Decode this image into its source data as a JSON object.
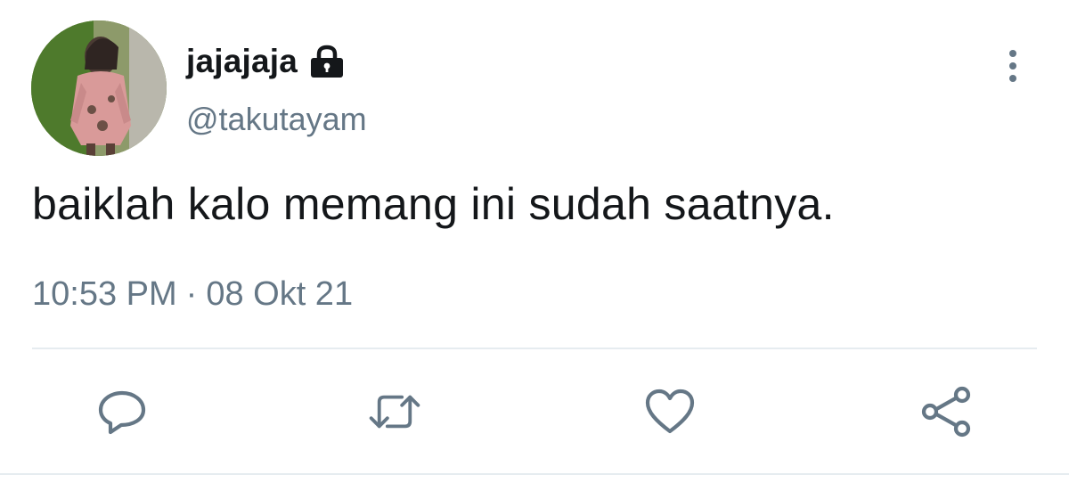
{
  "user": {
    "display_name": "jajajaja",
    "handle": "@takutayam",
    "protected_icon": "lock-icon",
    "avatar": "profile-photo"
  },
  "tweet": {
    "text": "baiklah kalo memang ini sudah saatnya.",
    "time": "10:53 PM",
    "separator": "·",
    "date": "08 Okt 21"
  },
  "actions": [
    {
      "name": "reply",
      "icon": "reply-icon"
    },
    {
      "name": "retweet",
      "icon": "retweet-icon"
    },
    {
      "name": "like",
      "icon": "heart-icon"
    },
    {
      "name": "share",
      "icon": "share-icon"
    }
  ],
  "menu_icon": "more-vertical-icon",
  "colors": {
    "text": "#14171a",
    "secondary": "#657786",
    "divider": "#e6ecf0",
    "background": "#ffffff"
  }
}
